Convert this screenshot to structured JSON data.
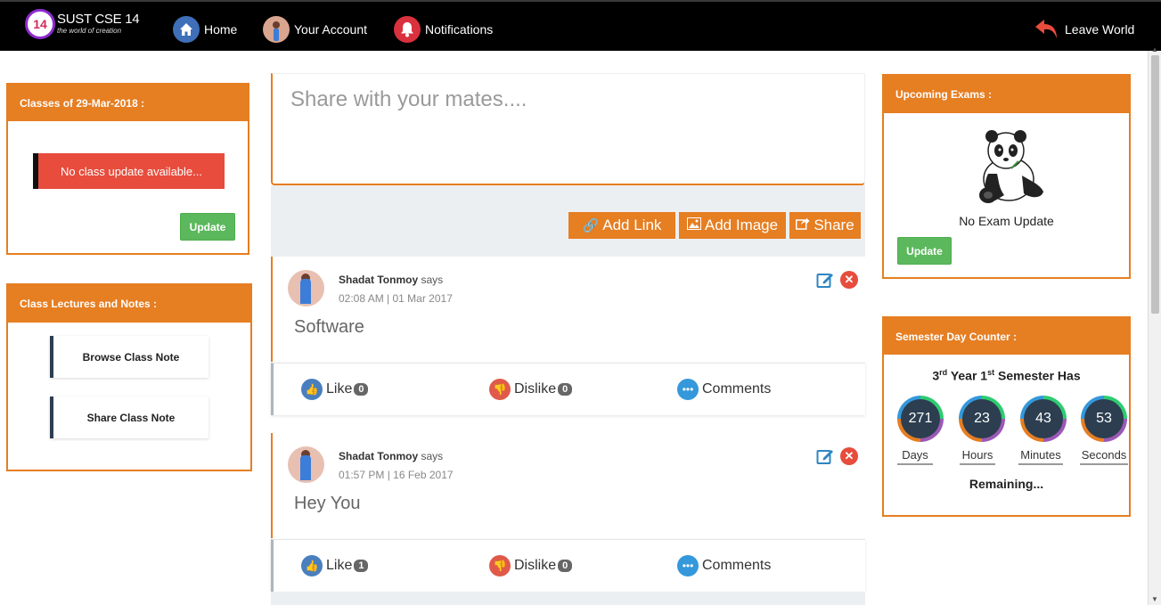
{
  "brand": {
    "badge": "14",
    "title": "SUST CSE 14",
    "subtitle": "the world of creation"
  },
  "nav": {
    "home": "Home",
    "account": "Your Account",
    "notifications": "Notifications",
    "leave": "Leave World"
  },
  "classes": {
    "title": "Classes of 29-Mar-2018 :",
    "message": "No class update available...",
    "update_label": "Update"
  },
  "lectures": {
    "title": "Class Lectures and Notes :",
    "browse": "Browse Class Note",
    "share": "Share Class Note"
  },
  "composer": {
    "placeholder": "Share with your mates....",
    "add_link": "Add Link",
    "add_image": "Add Image",
    "share": "Share"
  },
  "posts": [
    {
      "author": "Shadat Tonmoy",
      "says": "says",
      "time": "02:08 AM | 01 Mar 2017",
      "text": "Software",
      "like_label": "Like",
      "likes": "0",
      "dislike_label": "Dislike",
      "dislikes": "0",
      "comments_label": "Comments"
    },
    {
      "author": "Shadat Tonmoy",
      "says": "says",
      "time": "01:57 PM | 16 Feb 2017",
      "text": "Hey You",
      "like_label": "Like",
      "likes": "1",
      "dislike_label": "Dislike",
      "dislikes": "0",
      "comments_label": "Comments"
    }
  ],
  "exams": {
    "title": "Upcoming Exams :",
    "message": "No Exam Update",
    "update_label": "Update"
  },
  "counter": {
    "title": "Semester Day Counter :",
    "year": "3",
    "year_sup": "rd",
    "year_word": "Year",
    "sem": "1",
    "sem_sup": "st",
    "sem_word": "Semester Has",
    "days": "271",
    "days_label": "Days",
    "hours": "23",
    "hours_label": "Hours",
    "minutes": "43",
    "minutes_label": "Minutes",
    "seconds": "53",
    "seconds_label": "Seconds",
    "remaining": "Remaining..."
  },
  "colors": {
    "accent": "#e67e22",
    "topbar": "#000000",
    "success": "#5cb85c",
    "danger": "#e74c3c",
    "ring_fill": "#2c3e50"
  }
}
